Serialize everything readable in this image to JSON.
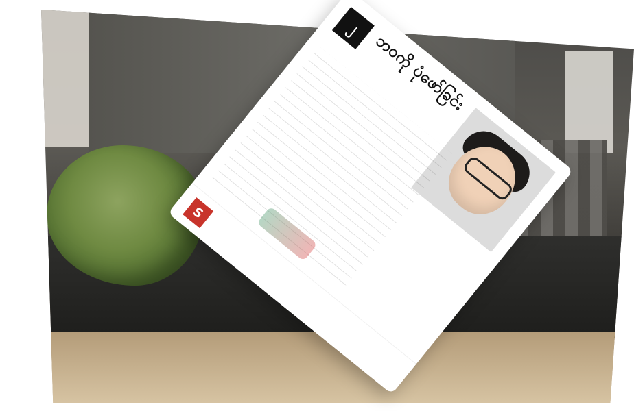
{
  "scene": {
    "card": {
      "title_text": "ဘဝကို ပုံဖော်ခြင်း",
      "top_badge_text": "၂",
      "footer_badge_text": "S"
    }
  }
}
